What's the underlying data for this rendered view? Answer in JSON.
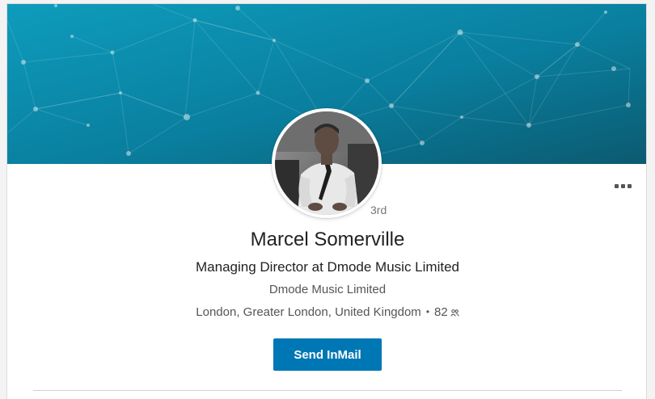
{
  "profile": {
    "name": "Marcel Somerville",
    "headline": "Managing Director at Dmode Music Limited",
    "company": "Dmode Music Limited",
    "location": "London, Greater London, United Kingdom",
    "separator": "•",
    "connections": "82",
    "degree": "3rd"
  },
  "actions": {
    "send_inmail_label": "Send InMail"
  },
  "icons": {
    "more": "more-horizontal-icon",
    "connections": "people-icon"
  },
  "colors": {
    "banner_start": "#0a8fb0",
    "banner_end": "#0a5f77",
    "primary_button": "#0077b5"
  }
}
